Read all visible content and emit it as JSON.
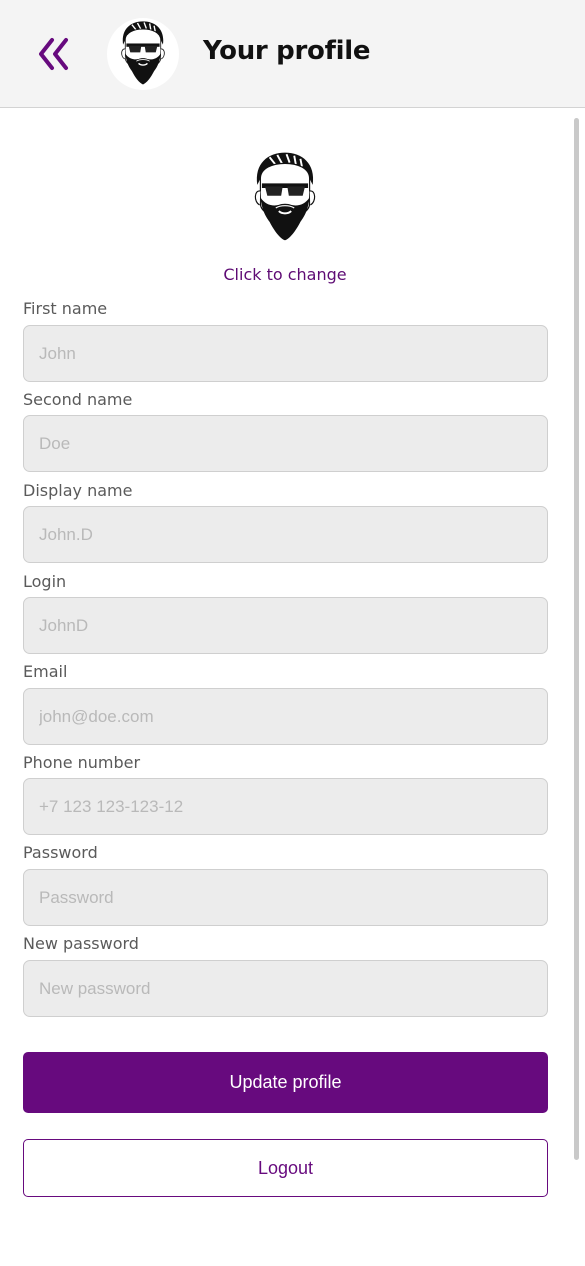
{
  "header": {
    "title": "Your profile",
    "back_icon": "double-chevron-left-icon",
    "avatar_icon": "bearded-man-avatar-icon"
  },
  "profile": {
    "avatar_icon": "bearded-man-avatar-icon",
    "change_link": "Click to change"
  },
  "fields": [
    {
      "label": "First name",
      "placeholder": "John"
    },
    {
      "label": "Second name",
      "placeholder": "Doe"
    },
    {
      "label": "Display name",
      "placeholder": "John.D"
    },
    {
      "label": "Login",
      "placeholder": "JohnD"
    },
    {
      "label": "Email",
      "placeholder": "john@doe.com"
    },
    {
      "label": "Phone number",
      "placeholder": "+7 123 123-123-12"
    },
    {
      "label": "Password",
      "placeholder": "Password"
    },
    {
      "label": "New password",
      "placeholder": "New password"
    }
  ],
  "buttons": {
    "update_label": "Update profile",
    "logout_label": "Logout"
  },
  "colors": {
    "accent": "#670a7e",
    "link": "#5e0b74",
    "header_bg": "#f4f4f4",
    "input_bg": "#ececec"
  }
}
